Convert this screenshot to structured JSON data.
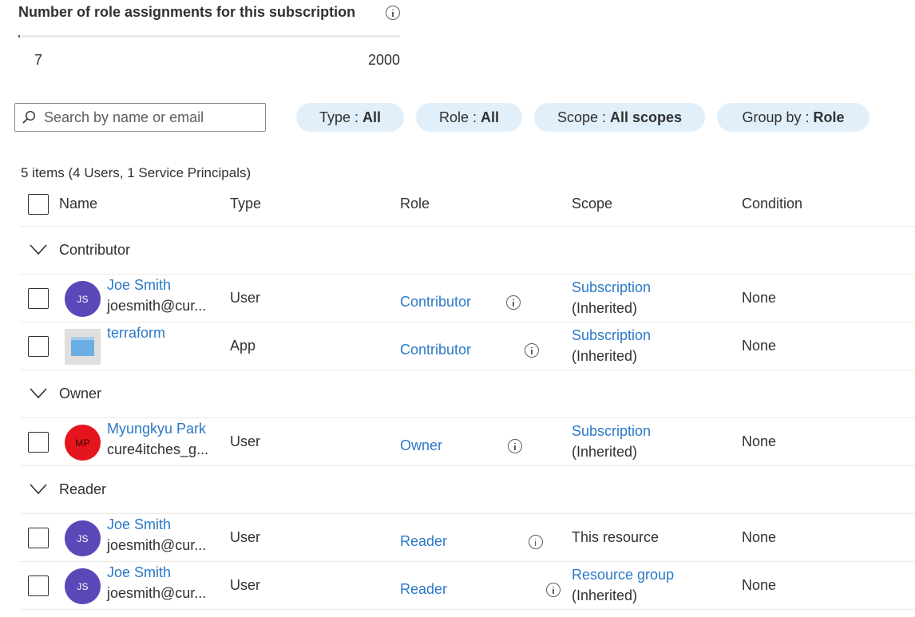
{
  "header": {
    "title": "Number of role assignments for this subscription",
    "info_icon": "info-icon",
    "progress": {
      "current": 7,
      "max": 2000,
      "min_label": "7",
      "max_label": "2000"
    }
  },
  "search": {
    "placeholder": "Search by name or email",
    "value": "",
    "icon": "search-icon"
  },
  "filters": {
    "type": {
      "label": "Type : ",
      "value": "All"
    },
    "role": {
      "label": "Role : ",
      "value": "All"
    },
    "scope": {
      "label": "Scope : ",
      "value": "All scopes"
    },
    "group_by": {
      "label": "Group by : ",
      "value": "Role"
    }
  },
  "summary": "5 items (4 Users, 1 Service Principals)",
  "columns": {
    "name": "Name",
    "type": "Type",
    "role": "Role",
    "scope": "Scope",
    "condition": "Condition"
  },
  "groups": [
    {
      "label": "Contributor"
    },
    {
      "label": "Owner"
    },
    {
      "label": "Reader"
    }
  ],
  "rows": [
    {
      "name": "Joe Smith",
      "secondary": "joesmith@cur...",
      "initials": "JS",
      "avatar_color": "#5c47b8",
      "type": "User",
      "role": "Contributor",
      "scope": "Subscription",
      "scope_note": "(Inherited)",
      "condition": "None"
    },
    {
      "name": "terraform",
      "secondary": "",
      "initials": "",
      "avatar_color": "#e1dfdd",
      "type": "App",
      "role": "Contributor",
      "scope": "Subscription",
      "scope_note": "(Inherited)",
      "condition": "None"
    },
    {
      "name": "Myungkyu Park",
      "secondary": "cure4itches_g...",
      "initials": "MP",
      "avatar_color": "#e5151e",
      "type": "User",
      "role": "Owner",
      "scope": "Subscription",
      "scope_note": "(Inherited)",
      "condition": "None"
    },
    {
      "name": "Joe Smith",
      "secondary": "joesmith@cur...",
      "initials": "JS",
      "avatar_color": "#5c47b8",
      "type": "User",
      "role": "Reader",
      "scope": "This resource",
      "scope_note": "",
      "condition": "None"
    },
    {
      "name": "Joe Smith",
      "secondary": "joesmith@cur...",
      "initials": "JS",
      "avatar_color": "#5c47b8",
      "type": "User",
      "role": "Reader",
      "scope": "Resource group",
      "scope_note": "(Inherited)",
      "condition": "None"
    }
  ],
  "colors": {
    "link": "#2b79c7",
    "pill_bg": "#e1effa",
    "text": "#323130"
  }
}
